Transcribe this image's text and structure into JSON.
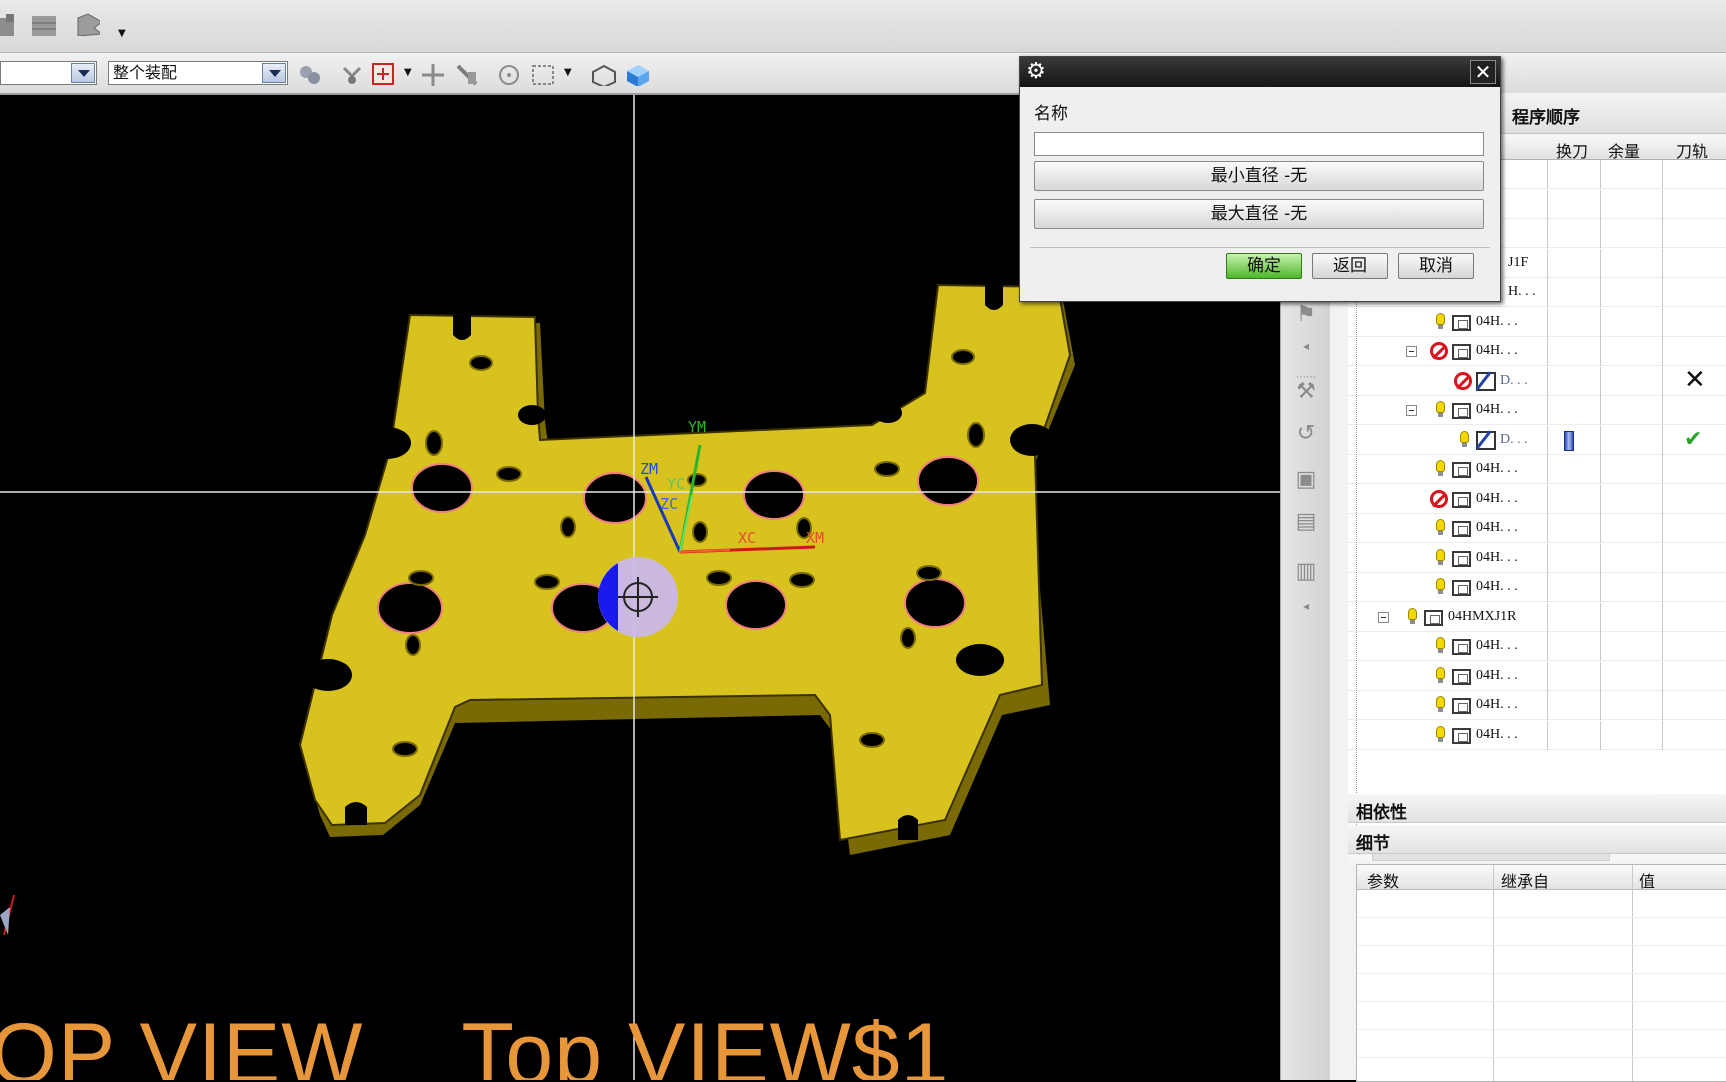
{
  "toolbar": {
    "filter_combo_value": "",
    "assembly_combo_value": "整个装配"
  },
  "viewport": {
    "view_label": "OP VIEW    Top VIEW$1",
    "axes": {
      "ym": "YM",
      "zm": "ZM",
      "yc": "YC",
      "zc": "ZC",
      "xc": "XC",
      "xm": "XM"
    }
  },
  "dialog": {
    "name_label": "名称",
    "name_value": "",
    "min_diameter_label": "最小直径 -无",
    "max_diameter_label": "最大直径 -无",
    "ok_label": "确定",
    "back_label": "返回",
    "cancel_label": "取消"
  },
  "navigator": {
    "title": "程序顺序",
    "columns": {
      "tool_change": "换刀",
      "stock": "余量",
      "toolpath": "刀轨"
    },
    "rows": [
      {
        "text": "",
        "icon": "none",
        "indent": 0,
        "expander": false,
        "tool": false,
        "status": ""
      },
      {
        "text": "",
        "icon": "none",
        "indent": 0,
        "expander": false,
        "tool": false,
        "status": ""
      },
      {
        "text": "",
        "icon": "none",
        "indent": 0,
        "expander": false,
        "tool": false,
        "status": ""
      },
      {
        "text": "J1F",
        "icon": "none",
        "indent": 0,
        "expander": false,
        "tool": false,
        "status": ""
      },
      {
        "text": "H. . .",
        "icon": "none",
        "indent": 0,
        "expander": false,
        "tool": false,
        "status": ""
      },
      {
        "text": "04H. . .",
        "icon": "bulb",
        "indent": 2,
        "expander": false,
        "tool": false,
        "status": ""
      },
      {
        "text": "04H. . .",
        "icon": "prohibited",
        "indent": 2,
        "expander": true,
        "tool": false,
        "status": ""
      },
      {
        "text": "D. . .",
        "icon": "prohibited",
        "indent": 3,
        "expander": false,
        "tool": false,
        "op": true,
        "status": "cross"
      },
      {
        "text": "04H. . .",
        "icon": "bulb",
        "indent": 2,
        "expander": true,
        "tool": false,
        "status": ""
      },
      {
        "text": "D. . .",
        "icon": "bulb",
        "indent": 3,
        "expander": false,
        "tool": true,
        "op": true,
        "status": "check"
      },
      {
        "text": "04H. . .",
        "icon": "bulb",
        "indent": 2,
        "expander": false,
        "tool": false,
        "status": ""
      },
      {
        "text": "04H. . .",
        "icon": "prohibited",
        "indent": 2,
        "expander": false,
        "tool": false,
        "status": ""
      },
      {
        "text": "04H. . .",
        "icon": "bulb",
        "indent": 2,
        "expander": false,
        "tool": false,
        "status": ""
      },
      {
        "text": "04H. . .",
        "icon": "bulb",
        "indent": 2,
        "expander": false,
        "tool": false,
        "status": ""
      },
      {
        "text": "04H. . .",
        "icon": "bulb",
        "indent": 2,
        "expander": false,
        "tool": false,
        "status": ""
      },
      {
        "text": "04HMXJ1R",
        "icon": "bulb",
        "indent": 1,
        "expander": true,
        "tool": false,
        "status": ""
      },
      {
        "text": "04H. . .",
        "icon": "bulb",
        "indent": 2,
        "expander": false,
        "tool": false,
        "status": ""
      },
      {
        "text": "04H. . .",
        "icon": "bulb",
        "indent": 2,
        "expander": false,
        "tool": false,
        "status": ""
      },
      {
        "text": "04H. . .",
        "icon": "bulb",
        "indent": 2,
        "expander": false,
        "tool": false,
        "status": ""
      },
      {
        "text": "04H. . .",
        "icon": "bulb",
        "indent": 2,
        "expander": false,
        "tool": false,
        "status": ""
      }
    ],
    "dependencies_label": "相依性",
    "details_label": "细节",
    "details_columns": {
      "param": "参数",
      "inherit": "继承自",
      "value": "值"
    }
  },
  "colors": {
    "part": "#d8c21e",
    "status_ok": "#2aa32a",
    "prohibited": "#d8141c",
    "view_label": "#e8963a"
  }
}
